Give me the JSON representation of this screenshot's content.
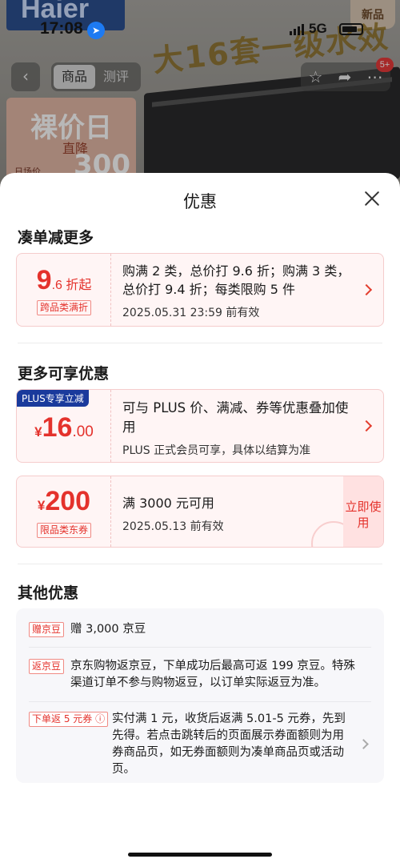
{
  "status_bar": {
    "time": "17:08",
    "network": "5G"
  },
  "background_page": {
    "brand": "Haier",
    "new_badge": "新品",
    "banner": "大16套一级水效",
    "promo_title": "裸价日",
    "promo_sub": "直降",
    "promo_amount": "300",
    "promo_small": "日场价",
    "nav": {
      "back": "‹",
      "tabs": [
        {
          "label": "商品"
        },
        {
          "label": "测评"
        }
      ],
      "badge": "5+"
    }
  },
  "sheet": {
    "title": "优惠",
    "sections": {
      "bundle": {
        "title": "凑单减更多",
        "card": {
          "rate_int": "9",
          "rate_rest": ".6 折起",
          "tag": "跨品类满折",
          "description": "购满 2 类，总价打 9.6 折；购满 3 类，总价打 9.4 折；每类限购 5 件",
          "validity": "2025.05.31 23:59 前有效"
        }
      },
      "more": {
        "title": "更多可享优惠",
        "plus_card": {
          "label": "PLUS专享立减",
          "currency": "¥",
          "amount_int": "16",
          "amount_dec": ".00",
          "description": "可与 PLUS 价、满减、券等优惠叠加使用",
          "note": "PLUS 正式会员可享，具体以结算为准"
        },
        "coupon_card": {
          "currency": "¥",
          "amount_int": "200",
          "tag": "限品类东券",
          "condition": "满 3000 元可用",
          "validity": "2025.05.13 前有效",
          "button": "立即使用"
        }
      },
      "other": {
        "title": "其他优惠",
        "items": [
          {
            "tag": "赠京豆",
            "text": "赠 3,000 京豆"
          },
          {
            "tag": "返京豆",
            "text": "京东购物返京豆，下单成功后最高可返 199 京豆。特殊渠道订单不参与购物返豆，以订单实际返豆为准。"
          },
          {
            "tag": "下单返 5 元券 ⓘ",
            "text": "实付满 1 元，收货后返满 5.01-5 元券，先到先得。若点击跳转后的页面展示券面额则为用券商品页，如无券面额则为凑单商品页或活动页。"
          }
        ]
      }
    }
  }
}
